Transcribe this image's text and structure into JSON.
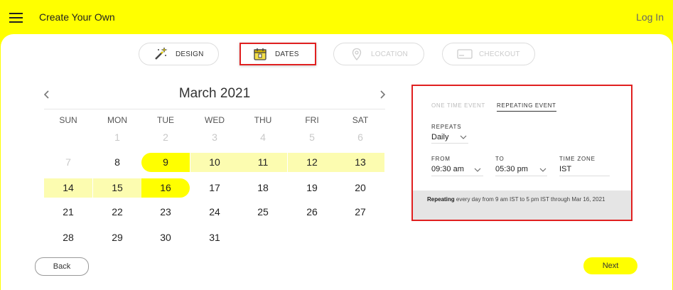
{
  "header": {
    "title": "Create Your Own",
    "login_label": "Log In"
  },
  "steps": [
    {
      "label": "DESIGN"
    },
    {
      "label": "DATES"
    },
    {
      "label": "LOCATION"
    },
    {
      "label": "CHECKOUT"
    }
  ],
  "calendar": {
    "month_label": "March 2021",
    "weekdays": [
      "SUN",
      "MON",
      "TUE",
      "WED",
      "THU",
      "FRI",
      "SAT"
    ],
    "rows": [
      [
        "",
        "1",
        "2",
        "3",
        "4",
        "5",
        "6"
      ],
      [
        "7",
        "8",
        "9",
        "10",
        "11",
        "12",
        "13"
      ],
      [
        "14",
        "15",
        "16",
        "17",
        "18",
        "19",
        "20"
      ],
      [
        "21",
        "22",
        "23",
        "24",
        "25",
        "26",
        "27"
      ],
      [
        "28",
        "29",
        "30",
        "31",
        "",
        "",
        ""
      ]
    ],
    "selected_range": {
      "start": "9",
      "end": "16"
    },
    "repeat_days_highlighted": [
      "9",
      "10",
      "11",
      "12",
      "13",
      "14",
      "15",
      "16"
    ]
  },
  "event_panel": {
    "tabs": [
      "ONE TIME EVENT",
      "REPEATING EVENT"
    ],
    "active_tab": "REPEATING EVENT",
    "repeats_label": "REPEATS",
    "repeats_value": "Daily",
    "from_label": "FROM",
    "from_value": "09:30 am",
    "to_label": "TO",
    "to_value": "05:30 pm",
    "timezone_label": "TIME ZONE",
    "timezone_value": "IST",
    "summary_bold": "Repeating",
    "summary_text": " every day from 9 am IST to 5 pm IST through Mar 16, 2021"
  },
  "buttons": {
    "back": "Back",
    "next": "Next"
  },
  "colors": {
    "accent": "#ffff00",
    "highlight": "#fcfcb0",
    "annotation": "#e02020"
  }
}
